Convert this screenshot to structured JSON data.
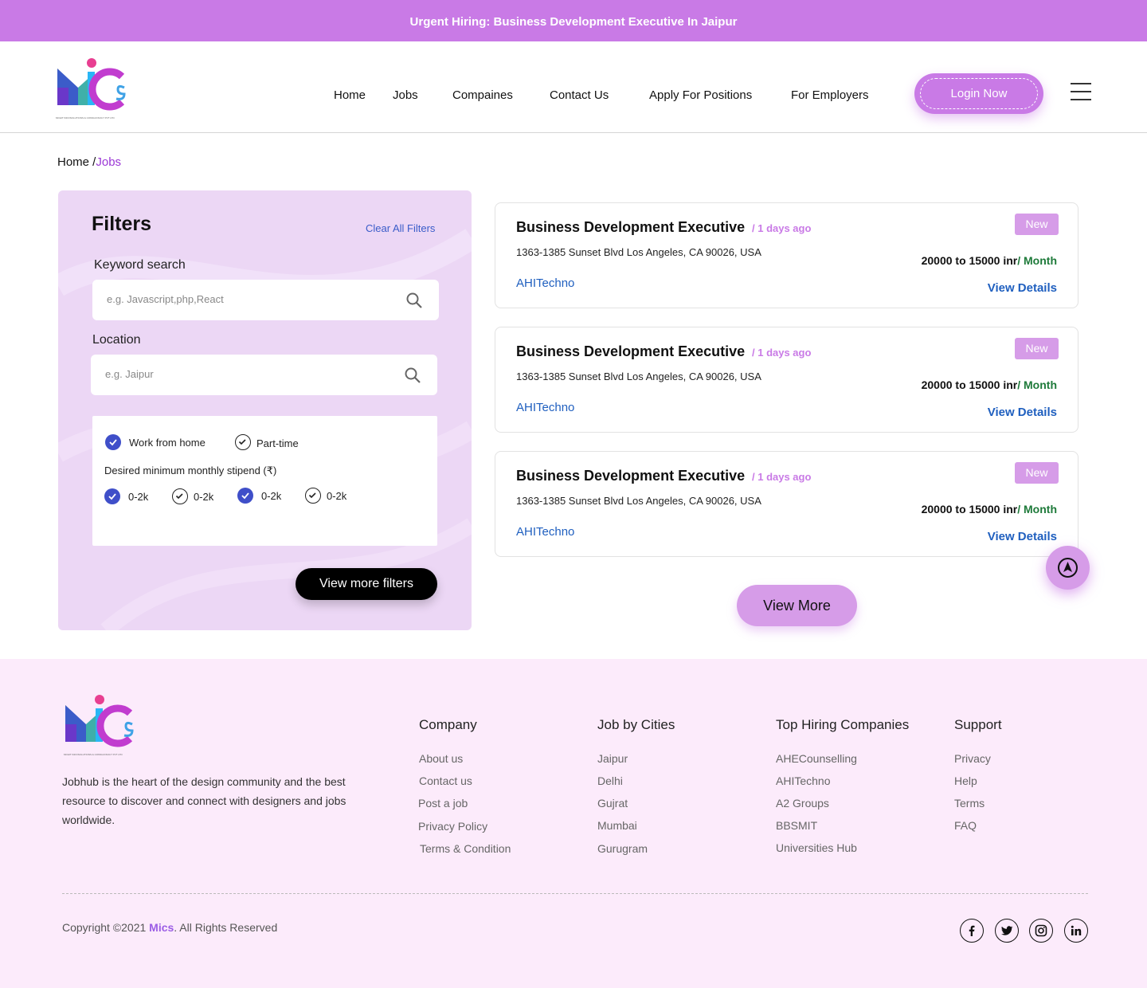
{
  "announcement": "Urgent Hiring: Business Development Executive In Jaipur",
  "logo": {
    "letters": "MICS",
    "tagline": "MOHIT INFOSOLUTIONS & CONSULTANCY PVT LTD"
  },
  "nav": [
    "Home",
    "Jobs",
    "Compaines",
    "Contact Us",
    "Apply For Positions",
    "For Employers"
  ],
  "login_label": "Login Now",
  "breadcrumb": {
    "home": "Home /",
    "current": "Jobs"
  },
  "filters": {
    "title": "Filters",
    "clear_all": "Clear All Filters",
    "keyword_label": "Keyword search",
    "keyword_placeholder": "e.g. Javascript,php,React",
    "location_label": "Location",
    "location_placeholder": "e.g. Jaipur",
    "work_from_home": "Work from home",
    "part_time": "Part-time",
    "stipend_label": "Desired minimum monthly stipend (₹)",
    "stipend_options": [
      "0-2k",
      "0-2k",
      "0-2k",
      "0-2k"
    ],
    "view_more_filters": "View more filters"
  },
  "jobs": [
    {
      "title": "Business Development Executive",
      "posted": "/ 1 days ago",
      "address": "1363-1385 Sunset Blvd Los Angeles, CA 90026, USA",
      "company": "AHITechno",
      "badge": "New",
      "salary": "20000 to 15000 inr",
      "period": "/ Month",
      "details": "View Details"
    },
    {
      "title": "Business Development Executive",
      "posted": "/ 1 days ago",
      "address": "1363-1385 Sunset Blvd Los Angeles, CA 90026, USA",
      "company": "AHITechno",
      "badge": "New",
      "salary": "20000 to 15000 inr",
      "period": "/ Month",
      "details": "View Details"
    },
    {
      "title": "Business Development Executive",
      "posted": "/ 1 days ago",
      "address": "1363-1385 Sunset Blvd Los Angeles, CA 90026, USA",
      "company": "AHITechno",
      "badge": "New",
      "salary": "20000 to 15000 inr",
      "period": "/ Month",
      "details": "View Details"
    }
  ],
  "view_more": "View More",
  "footer": {
    "description": "Jobhub is the heart of the design community and the best resource to discover and connect with designers and jobs worldwide.",
    "columns": [
      {
        "title": "Company",
        "links": [
          "About us",
          "Contact us",
          "Post a job",
          "Privacy Policy",
          "Terms & Condition"
        ]
      },
      {
        "title": "Job by Cities",
        "links": [
          "Jaipur",
          "Delhi",
          "Gujrat",
          "Mumbai",
          "Gurugram"
        ]
      },
      {
        "title": "Top Hiring Companies",
        "links": [
          "AHECounselling",
          "AHITechno",
          "A2 Groups",
          "BBSMIT",
          "Universities Hub"
        ]
      },
      {
        "title": "Support",
        "links": [
          "Privacy",
          "Help",
          "Terms",
          "FAQ"
        ]
      }
    ],
    "copyright_pre": "Copyright ©2021 ",
    "copyright_brand": "Mics",
    "copyright_post": ". All Rights Reserved"
  },
  "colors": {
    "accent": "#c97ae6",
    "badge": "#d69ce8",
    "link": "#1f5fbf",
    "check": "#3f4fc9",
    "footer_bg": "#fcebfb"
  },
  "icons": [
    "search-icon",
    "hamburger-icon",
    "check-icon",
    "navigation-arrow-icon",
    "facebook-icon",
    "twitter-icon",
    "instagram-icon",
    "linkedin-icon"
  ]
}
